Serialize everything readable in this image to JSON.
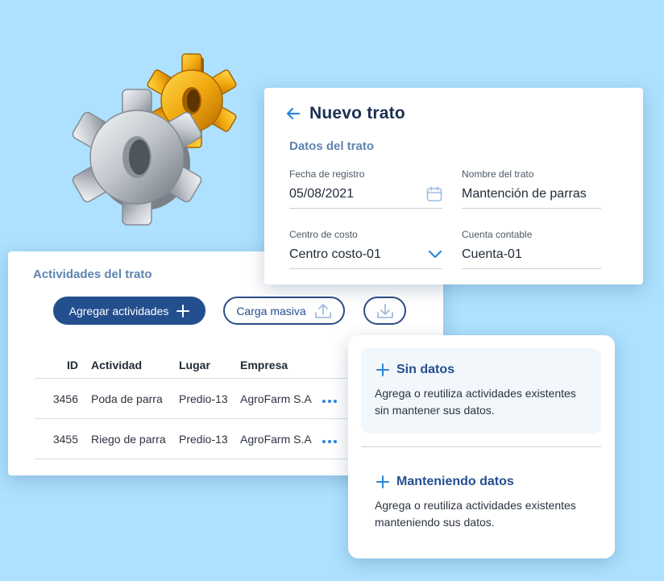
{
  "deal_form": {
    "title": "Nuevo trato",
    "section_title": "Datos del trato",
    "fields": [
      {
        "label": "Fecha de registro",
        "value": "05/08/2021"
      },
      {
        "label": "Nombre del trato",
        "value": "Mantención de parras"
      },
      {
        "label": "Centro de costo",
        "value": "Centro costo-01"
      },
      {
        "label": "Cuenta contable",
        "value": "Cuenta-01"
      }
    ]
  },
  "activities": {
    "title": "Actividades del trato",
    "add_button": "Agregar actividades",
    "bulk_button": "Carga masiva",
    "columns": [
      "ID",
      "Actividad",
      "Lugar",
      "Empresa"
    ],
    "rows": [
      {
        "id": "3456",
        "actividad": "Poda de parra",
        "lugar": "Predio-13",
        "empresa": "AgroFarm S.A"
      },
      {
        "id": "3455",
        "actividad": "Riego de parra",
        "lugar": "Predio-13",
        "empresa": "AgroFarm S.A"
      }
    ]
  },
  "options": [
    {
      "title": "Sin datos",
      "description": "Agrega o reutiliza actividades existentes sin mantener sus datos."
    },
    {
      "title": "Manteniendo datos",
      "description": "Agrega o reutiliza actividades existentes manteniendo sus datos."
    }
  ],
  "colors": {
    "background": "#ade1ff",
    "primary": "#244f8f",
    "accent": "#2a86d8",
    "section": "#5e84b0"
  },
  "icons": [
    "gears-icon",
    "back-arrow-icon",
    "calendar-icon",
    "chevron-down-icon",
    "plus-icon",
    "upload-icon",
    "download-icon",
    "more-icon"
  ]
}
